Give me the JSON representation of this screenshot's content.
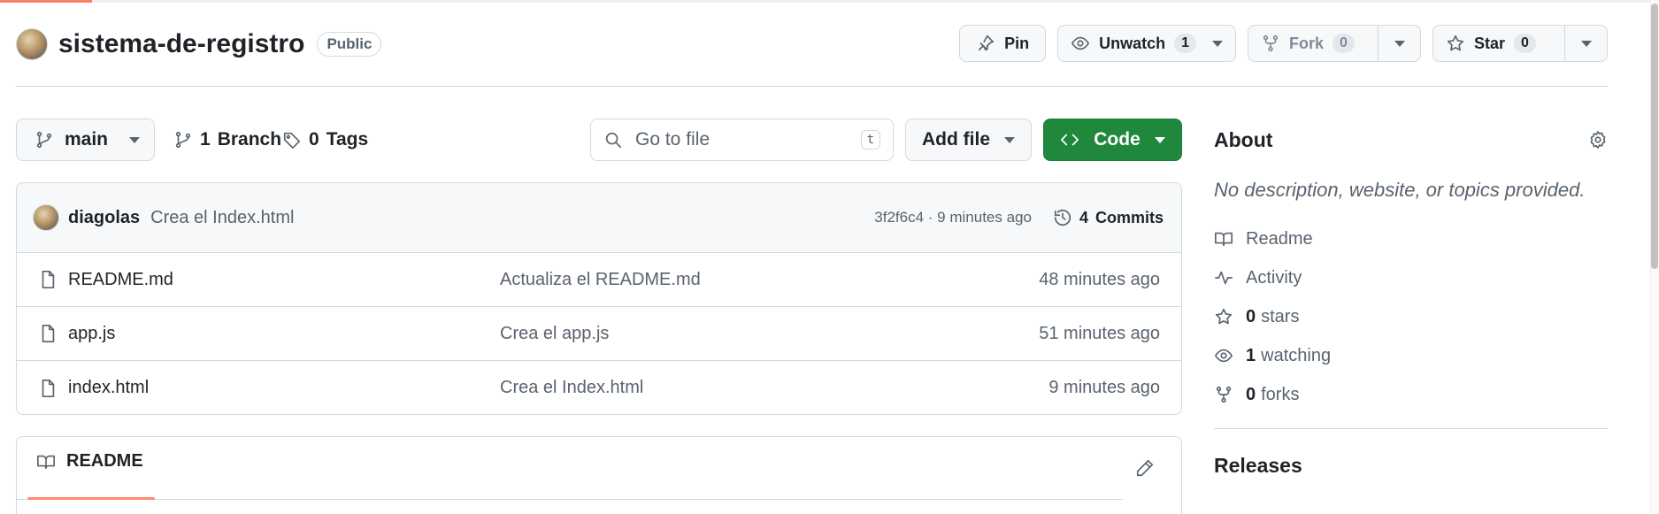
{
  "repo": {
    "name": "sistema-de-registro",
    "visibility": "Public"
  },
  "actions": {
    "pin": "Pin",
    "unwatch": "Unwatch",
    "unwatch_count": "1",
    "fork": "Fork",
    "fork_count": "0",
    "star": "Star",
    "star_count": "0"
  },
  "branch_bar": {
    "branch": "main",
    "branches_count": "1",
    "branches_label": "Branch",
    "tags_count": "0",
    "tags_label": "Tags",
    "goto_placeholder": "Go to file",
    "goto_shortcut": "t",
    "add_file": "Add file",
    "code": "Code"
  },
  "latest_commit": {
    "author": "diagolas",
    "message": "Crea el Index.html",
    "meta": "3f2f6c4 · 9 minutes ago",
    "commits_count": "4",
    "commits_label": "Commits"
  },
  "files": [
    {
      "name": "README.md",
      "message": "Actualiza el README.md",
      "age": "48 minutes ago"
    },
    {
      "name": "app.js",
      "message": "Crea el app.js",
      "age": "51 minutes ago"
    },
    {
      "name": "index.html",
      "message": "Crea el Index.html",
      "age": "9 minutes ago"
    }
  ],
  "readme": {
    "tab": "README"
  },
  "sidebar": {
    "about": "About",
    "description": "No description, website, or topics provided.",
    "items": [
      {
        "icon": "book-icon",
        "count": "",
        "label": "Readme"
      },
      {
        "icon": "pulse-icon",
        "count": "",
        "label": "Activity"
      },
      {
        "icon": "star-icon",
        "count": "0",
        "label": "stars"
      },
      {
        "icon": "eye-icon",
        "count": "1",
        "label": "watching"
      },
      {
        "icon": "fork-icon",
        "count": "0",
        "label": "forks"
      }
    ],
    "releases": "Releases"
  }
}
